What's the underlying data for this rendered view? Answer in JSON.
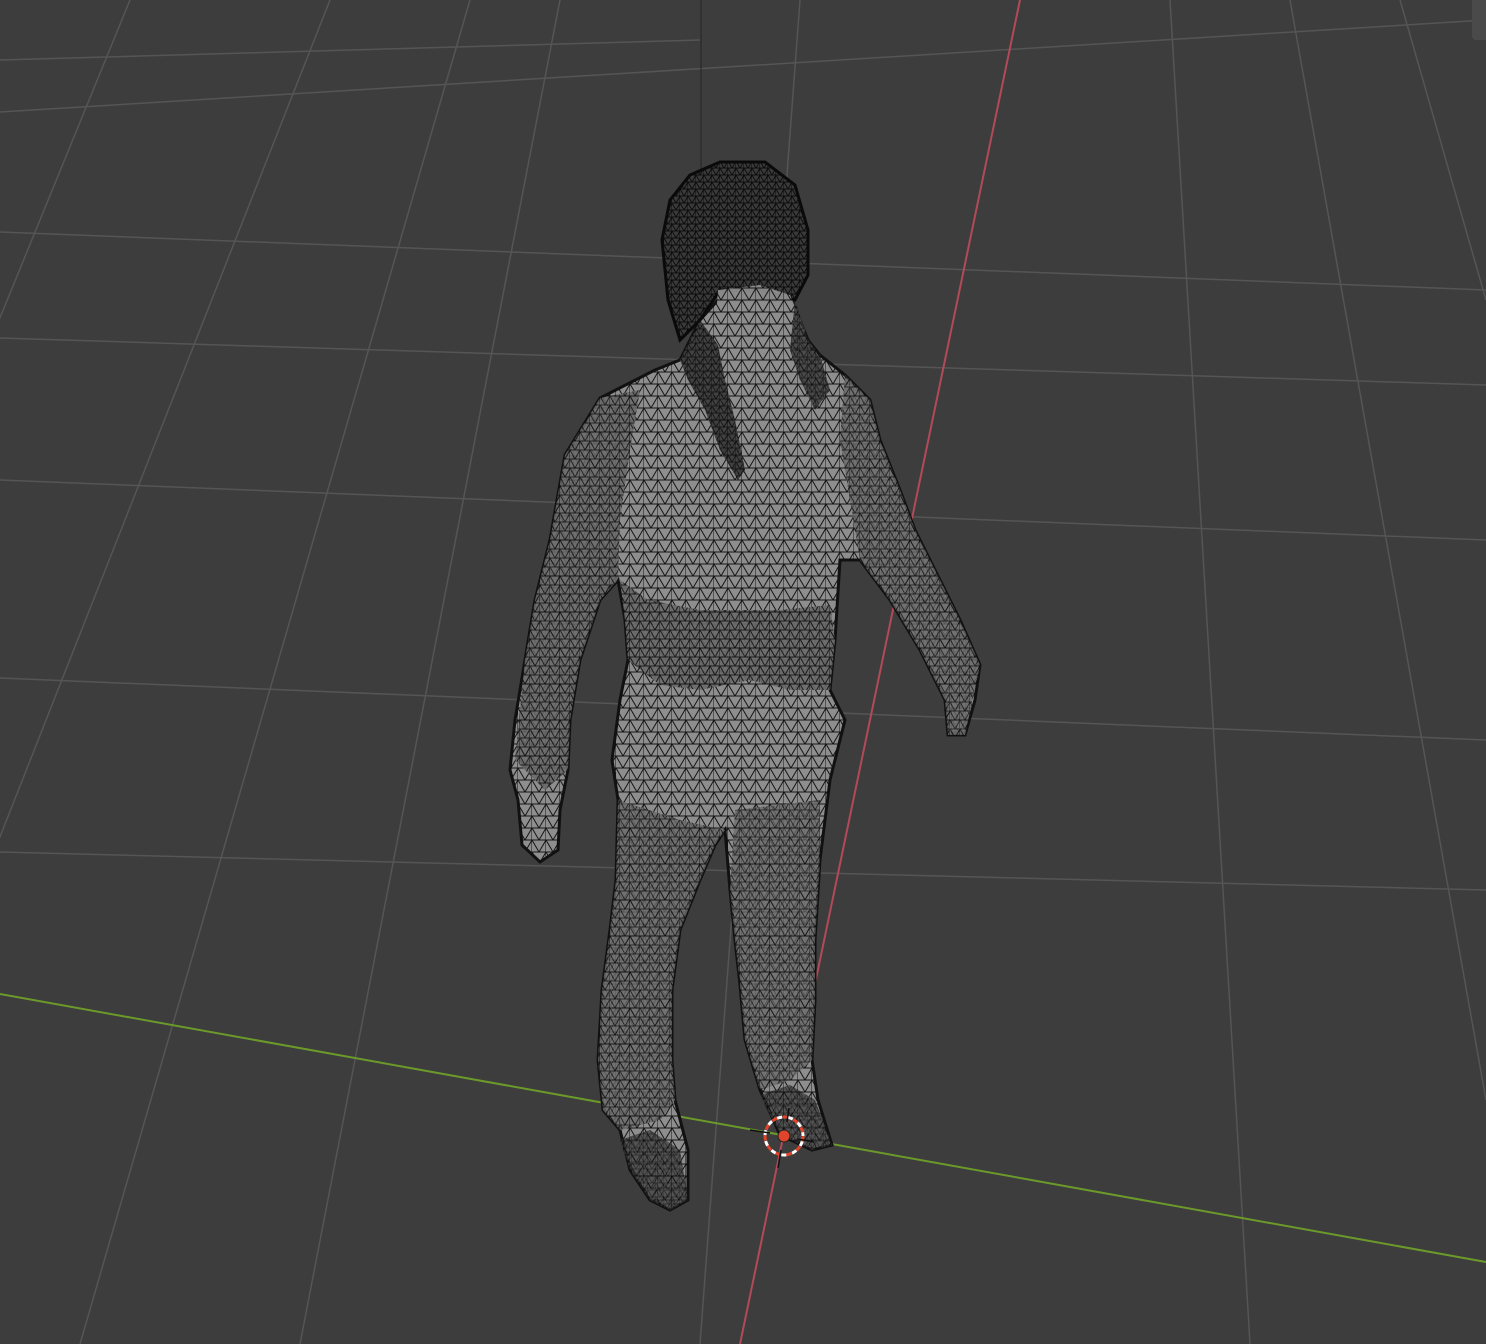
{
  "viewport": {
    "background": "#3d3d3d",
    "grid_color": "#555555",
    "x_axis_color": "#b24a59",
    "y_axis_color": "#6c9a2a",
    "vertical_guide_color": "#222222",
    "mesh_face_color": "#8c8c8c",
    "mesh_wire_color": "#111111",
    "cursor_color": "#e0442b",
    "cursor_ring_color": "#ffffff"
  },
  "objects": {
    "mesh": "human-figure-wireframe-mesh",
    "cursor": "3d-cursor-icon",
    "origin": "object-origin-point"
  }
}
